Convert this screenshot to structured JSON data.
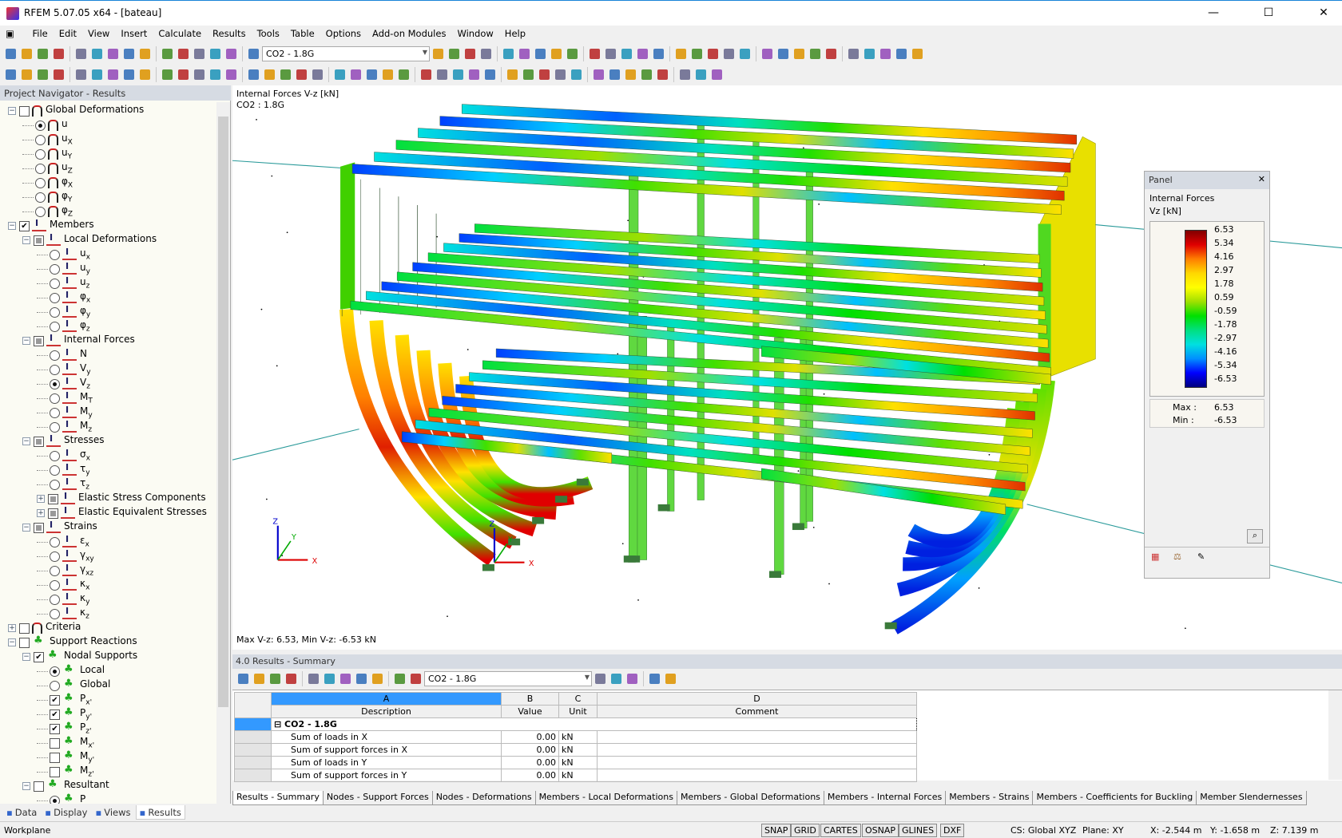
{
  "window": {
    "title": "RFEM 5.07.05 x64 - [bateau]",
    "minimize": "—",
    "maximize": "☐",
    "close": "✕"
  },
  "menu": [
    "File",
    "Edit",
    "View",
    "Insert",
    "Calculate",
    "Results",
    "Tools",
    "Table",
    "Options",
    "Add-on Modules",
    "Window",
    "Help"
  ],
  "toolbar1": {
    "load_case": "CO2 - 1.8G",
    "icons": [
      "new-icon",
      "open-icon",
      "save-icon",
      "print-icon",
      "undo-icon",
      "redo-icon",
      "calculate-icon",
      "results-icon",
      "view-icon",
      "render-icon",
      "nav-prev-icon",
      "nav-next-icon",
      "display-icon",
      "deformation-icon",
      "section-icon",
      "zoom-icon",
      "rotate-icon",
      "pan-icon",
      "isometric-icon",
      "select-icon",
      "filter-icon",
      "export-icon"
    ]
  },
  "toolbar2": {
    "icons": [
      "node-icon",
      "line-icon",
      "member-icon",
      "surface-icon",
      "support-icon",
      "load-icon",
      "hinge-icon",
      "grid-icon",
      "dimension-icon",
      "comment-icon",
      "view-x-icon",
      "view-y-icon",
      "view-z-icon",
      "iso-icon",
      "wireframe-icon",
      "solid-icon",
      "transparent-icon",
      "color-icon",
      "section-icon",
      "measure-icon",
      "table-icon",
      "legend-icon"
    ]
  },
  "navigator": {
    "title": "Project Navigator - Results",
    "tabs": [
      {
        "label": "Data",
        "icon": "data-icon"
      },
      {
        "label": "Display",
        "icon": "display-icon"
      },
      {
        "label": "Views",
        "icon": "views-icon"
      },
      {
        "label": "Results",
        "icon": "results-icon"
      }
    ],
    "items": [
      {
        "level": 0,
        "tog": "−",
        "ctl": "cb",
        "state": "off",
        "icon": "def",
        "label": "Global Deformations",
        "sub": ""
      },
      {
        "level": 1,
        "ctl": "rd",
        "state": "on",
        "icon": "def",
        "label": "u",
        "sub": ""
      },
      {
        "level": 1,
        "ctl": "rd",
        "state": "off",
        "icon": "def",
        "label": "u",
        "sub": "X"
      },
      {
        "level": 1,
        "ctl": "rd",
        "state": "off",
        "icon": "def",
        "label": "u",
        "sub": "Y"
      },
      {
        "level": 1,
        "ctl": "rd",
        "state": "off",
        "icon": "def",
        "label": "u",
        "sub": "Z"
      },
      {
        "level": 1,
        "ctl": "rd",
        "state": "off",
        "icon": "def",
        "label": "φ",
        "sub": "X"
      },
      {
        "level": 1,
        "ctl": "rd",
        "state": "off",
        "icon": "def",
        "label": "φ",
        "sub": "Y"
      },
      {
        "level": 1,
        "ctl": "rd",
        "state": "off",
        "icon": "def",
        "label": "φ",
        "sub": "Z"
      },
      {
        "level": 0,
        "tog": "−",
        "ctl": "cb",
        "state": "on",
        "icon": "mem",
        "label": "Members",
        "sub": ""
      },
      {
        "level": 1,
        "tog": "−",
        "ctl": "cb",
        "state": "partial",
        "icon": "mem",
        "label": "Local Deformations",
        "sub": ""
      },
      {
        "level": 2,
        "ctl": "rd",
        "state": "off",
        "icon": "mem",
        "label": "u",
        "sub": "x"
      },
      {
        "level": 2,
        "ctl": "rd",
        "state": "off",
        "icon": "mem",
        "label": "u",
        "sub": "y"
      },
      {
        "level": 2,
        "ctl": "rd",
        "state": "off",
        "icon": "mem",
        "label": "u",
        "sub": "z"
      },
      {
        "level": 2,
        "ctl": "rd",
        "state": "off",
        "icon": "mem",
        "label": "φ",
        "sub": "x"
      },
      {
        "level": 2,
        "ctl": "rd",
        "state": "off",
        "icon": "mem",
        "label": "φ",
        "sub": "y"
      },
      {
        "level": 2,
        "ctl": "rd",
        "state": "off",
        "icon": "mem",
        "label": "φ",
        "sub": "z"
      },
      {
        "level": 1,
        "tog": "−",
        "ctl": "cb",
        "state": "partial",
        "icon": "mem",
        "label": "Internal Forces",
        "sub": ""
      },
      {
        "level": 2,
        "ctl": "rd",
        "state": "off",
        "icon": "mem",
        "label": "N",
        "sub": ""
      },
      {
        "level": 2,
        "ctl": "rd",
        "state": "off",
        "icon": "mem",
        "label": "V",
        "sub": "y"
      },
      {
        "level": 2,
        "ctl": "rd",
        "state": "on",
        "icon": "mem",
        "label": "V",
        "sub": "z"
      },
      {
        "level": 2,
        "ctl": "rd",
        "state": "off",
        "icon": "mem",
        "label": "M",
        "sub": "T"
      },
      {
        "level": 2,
        "ctl": "rd",
        "state": "off",
        "icon": "mem",
        "label": "M",
        "sub": "y"
      },
      {
        "level": 2,
        "ctl": "rd",
        "state": "off",
        "icon": "mem",
        "label": "M",
        "sub": "z"
      },
      {
        "level": 1,
        "tog": "−",
        "ctl": "cb",
        "state": "partial",
        "icon": "mem",
        "label": "Stresses",
        "sub": ""
      },
      {
        "level": 2,
        "ctl": "rd",
        "state": "off",
        "icon": "mem",
        "label": "σ",
        "sub": "x"
      },
      {
        "level": 2,
        "ctl": "rd",
        "state": "off",
        "icon": "mem",
        "label": "τ",
        "sub": "y"
      },
      {
        "level": 2,
        "ctl": "rd",
        "state": "off",
        "icon": "mem",
        "label": "τ",
        "sub": "z"
      },
      {
        "level": 2,
        "tog": "+",
        "ctl": "cb",
        "state": "partial",
        "icon": "mem",
        "label": "Elastic Stress Components",
        "sub": ""
      },
      {
        "level": 2,
        "tog": "+",
        "ctl": "cb",
        "state": "partial",
        "icon": "mem",
        "label": "Elastic Equivalent Stresses",
        "sub": ""
      },
      {
        "level": 1,
        "tog": "−",
        "ctl": "cb",
        "state": "partial",
        "icon": "mem",
        "label": "Strains",
        "sub": ""
      },
      {
        "level": 2,
        "ctl": "rd",
        "state": "off",
        "icon": "mem",
        "label": "ε",
        "sub": "x"
      },
      {
        "level": 2,
        "ctl": "rd",
        "state": "off",
        "icon": "mem",
        "label": "γ",
        "sub": "xy"
      },
      {
        "level": 2,
        "ctl": "rd",
        "state": "off",
        "icon": "mem",
        "label": "γ",
        "sub": "xz"
      },
      {
        "level": 2,
        "ctl": "rd",
        "state": "off",
        "icon": "mem",
        "label": "κ",
        "sub": "x"
      },
      {
        "level": 2,
        "ctl": "rd",
        "state": "off",
        "icon": "mem",
        "label": "κ",
        "sub": "y"
      },
      {
        "level": 2,
        "ctl": "rd",
        "state": "off",
        "icon": "mem",
        "label": "κ",
        "sub": "z"
      },
      {
        "level": 0,
        "tog": "+",
        "ctl": "cb",
        "state": "off",
        "icon": "def",
        "label": "Criteria",
        "sub": ""
      },
      {
        "level": 0,
        "tog": "−",
        "ctl": "cb",
        "state": "off",
        "icon": "sup",
        "label": "Support Reactions",
        "sub": ""
      },
      {
        "level": 1,
        "tog": "−",
        "ctl": "cb",
        "state": "on",
        "icon": "sup",
        "label": "Nodal Supports",
        "sub": ""
      },
      {
        "level": 2,
        "ctl": "rd",
        "state": "on",
        "icon": "sup",
        "label": "Local",
        "sub": ""
      },
      {
        "level": 2,
        "ctl": "rd",
        "state": "off",
        "icon": "sup",
        "label": "Global",
        "sub": ""
      },
      {
        "level": 2,
        "ctl": "cb",
        "state": "on",
        "icon": "sup",
        "label": "P",
        "sub": "x'"
      },
      {
        "level": 2,
        "ctl": "cb",
        "state": "on",
        "icon": "sup",
        "label": "P",
        "sub": "y'"
      },
      {
        "level": 2,
        "ctl": "cb",
        "state": "on",
        "icon": "sup",
        "label": "P",
        "sub": "z'"
      },
      {
        "level": 2,
        "ctl": "cb",
        "state": "off",
        "icon": "sup",
        "label": "M",
        "sub": "x'"
      },
      {
        "level": 2,
        "ctl": "cb",
        "state": "off",
        "icon": "sup",
        "label": "M",
        "sub": "y'"
      },
      {
        "level": 2,
        "ctl": "cb",
        "state": "off",
        "icon": "sup",
        "label": "M",
        "sub": "z'"
      },
      {
        "level": 1,
        "tog": "−",
        "ctl": "cb",
        "state": "off",
        "icon": "sup",
        "label": "Resultant",
        "sub": ""
      },
      {
        "level": 2,
        "ctl": "rd",
        "state": "on",
        "icon": "sup",
        "label": "P",
        "sub": ""
      }
    ]
  },
  "viewport": {
    "title": "Internal Forces V-z [kN]",
    "load_case": "CO2 : 1.8G",
    "footer": "Max V-z: 6.53, Min V-z: -6.53 kN",
    "axes": {
      "x": "X",
      "y": "Y",
      "z": "Z"
    }
  },
  "panel": {
    "title": "Panel",
    "heading": "Internal Forces",
    "unit": "Vz [kN]",
    "legend": [
      "6.53",
      "5.34",
      "4.16",
      "2.97",
      "1.78",
      "0.59",
      "-0.59",
      "-1.78",
      "-2.97",
      "-4.16",
      "-5.34",
      "-6.53"
    ],
    "max_label": "Max :",
    "max": "6.53",
    "min_label": "Min :",
    "min": "-6.53",
    "colors": [
      "#800000",
      "#e00000",
      "#ff7f00",
      "#ffff00",
      "#00e000",
      "#00e0e0",
      "#0000ff",
      "#000080"
    ]
  },
  "results": {
    "title": "4.0 Results - Summary",
    "load_case": "CO2 - 1.8G",
    "columns": [
      "A",
      "B",
      "C",
      "D"
    ],
    "headers": [
      "Description",
      "Value",
      "Unit",
      "Comment"
    ],
    "group": "CO2 - 1.8G",
    "rows": [
      {
        "desc": "Sum of loads in X",
        "value": "0.00",
        "unit": "kN"
      },
      {
        "desc": "Sum of support forces in X",
        "value": "0.00",
        "unit": "kN"
      },
      {
        "desc": "Sum of loads in Y",
        "value": "0.00",
        "unit": "kN"
      },
      {
        "desc": "Sum of support forces in Y",
        "value": "0.00",
        "unit": "kN"
      }
    ],
    "tabs": [
      "Results - Summary",
      "Nodes - Support Forces",
      "Nodes - Deformations",
      "Members - Local Deformations",
      "Members - Global Deformations",
      "Members - Internal Forces",
      "Members - Strains",
      "Members - Coefficients for Buckling",
      "Member Slendernesses"
    ]
  },
  "status": {
    "left": "Workplane",
    "toggles": [
      "SNAP",
      "GRID",
      "CARTES",
      "OSNAP",
      "GLINES",
      "DXF"
    ],
    "cs": "CS: Global XYZ",
    "plane": "Plane: XY",
    "x": "X: -2.544 m",
    "y": "Y: -1.658 m",
    "z": "Z: 7.139 m"
  }
}
